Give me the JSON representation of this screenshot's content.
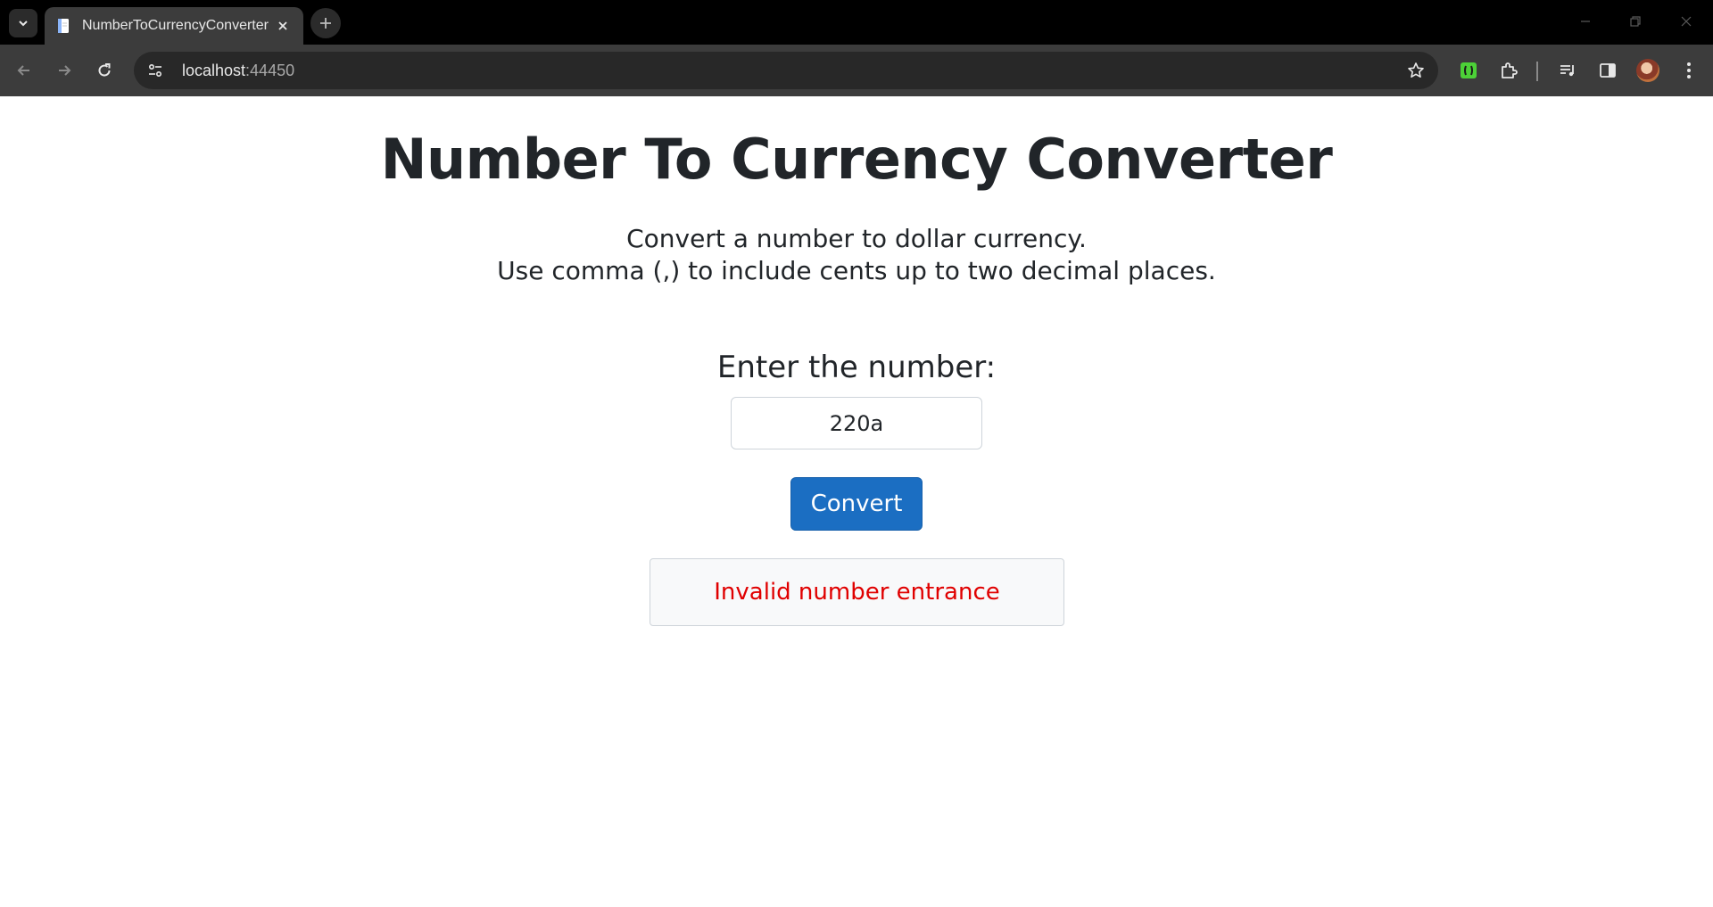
{
  "browser": {
    "tab_title": "NumberToCurrencyConverter",
    "url_host": "localhost",
    "url_port": ":44450",
    "icons": [
      "tab-search-icon",
      "favicon-icon",
      "close-icon",
      "plus-icon",
      "minimize-icon",
      "restore-icon",
      "window-close-icon",
      "back-arrow-icon",
      "forward-arrow-icon",
      "reload-icon",
      "site-info-icon",
      "star-icon",
      "extension-green-icon",
      "extensions-puzzle-icon",
      "media-control-icon",
      "side-panel-icon",
      "profile-avatar",
      "menu-dots-icon"
    ]
  },
  "page": {
    "title": "Number To Currency Converter",
    "description_line1": "Convert a number to dollar currency.",
    "description_line2": "Use comma (,) to include cents up to two decimal places.",
    "input_label": "Enter the number:",
    "input_value": "220a",
    "convert_label": "Convert",
    "result_message": "Invalid number entrance"
  },
  "colors": {
    "primary_button": "#1b6ec2",
    "error_text": "#e00000",
    "heading_text": "#212529",
    "result_background": "#f8f9fa"
  }
}
